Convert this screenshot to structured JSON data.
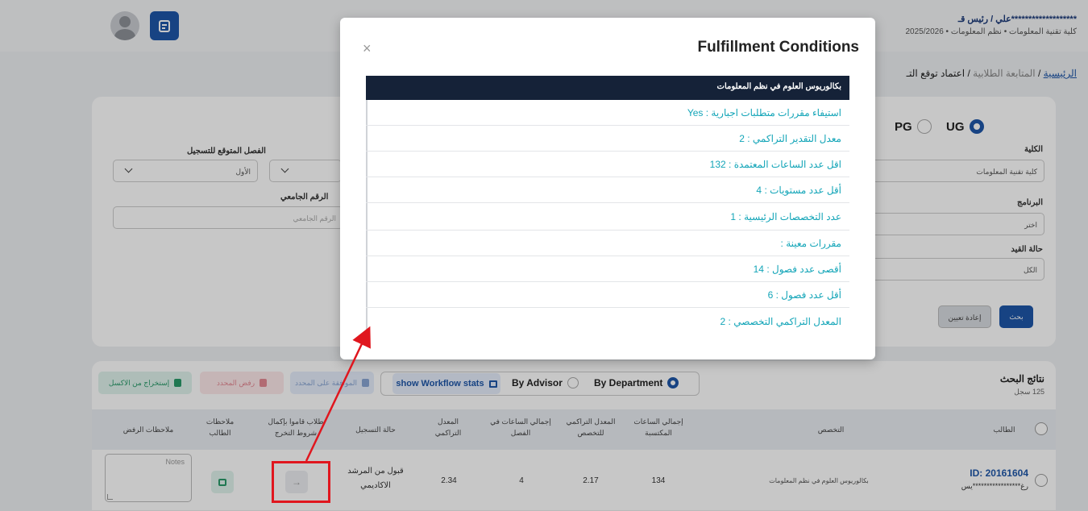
{
  "header": {
    "user_name": "*******************علي / رئيس قـ",
    "user_sub": "كلية تقنية المعلومات  •  نظم المعلومات  •  2025/2026",
    "breadcrumb_home": "الرئيسية",
    "breadcrumb_mid": "المتابعة الطلابية",
    "breadcrumb_current": "اعتماد توقع التـ",
    "sep": " / "
  },
  "filters": {
    "ug_label": "UG",
    "pg_label": "PG",
    "college_label": "الكلية",
    "college_value": "كلية تقنية المعلومات",
    "program_label": "البرنامج",
    "program_value": "اختر",
    "status_label": "حالة القيد",
    "status_value": "الكل",
    "semester_label": "الفصل المتوقع للتسجيل",
    "semester_value": "الأول",
    "univ_id_label": "الرقم الجامعي",
    "univ_id_placeholder": "الرقم الجامعي",
    "search_btn": "بحث",
    "reset_btn": "إعادة تعيين"
  },
  "results": {
    "title": "نتائج البحث",
    "count": "125 سجل",
    "export_btn": "إستخراج من الاكسل",
    "reject_btn": "رفض المحدد",
    "approve_btn": "الموافقة على المحدد",
    "workflow_btn": "show Workflow stats",
    "by_advisor": "By Advisor",
    "by_department": "By Department",
    "columns": {
      "student": "الطالب",
      "major": "التخصص",
      "total_hours": "إجمالي الساعات المكتسبة",
      "major_gpa": "المعدل التراكمي للتخصص",
      "sem_hours": "إجمالي الساعات في الفصل",
      "gpa": "المعدل التراكمي",
      "reg_status": "حالة التسجيل",
      "fulfilled": "طلاب قاموا بإكمال شروط التخرج",
      "student_notes": "ملاحظات الطالب",
      "reject_notes": "ملاحظات الرفض"
    },
    "row": {
      "id": "ID: 20161604",
      "name": "رغ*****************يس",
      "major": "بكالوريوس العلوم في نظم المعلومات",
      "total_hours": "134",
      "major_gpa": "2.17",
      "sem_hours": "4",
      "gpa": "2.34",
      "reg_status": "قبول من المرشد الاكاديمي",
      "notes_placeholder": "Notes",
      "arrow": "→"
    }
  },
  "modal": {
    "title": "Fulfillment Conditions",
    "close": "×",
    "program": "بكالوريوس العلوم في نظم المعلومات",
    "conditions": [
      "استيفاء مقررات متطلبات اجبارية : Yes",
      "معدل التقدير التراكمي : 2",
      "اقل عدد الساعات المعتمدة : 132",
      "أقل عدد مستويات : 4",
      "عدد التخصصات الرئيسية : 1",
      "مقررات معينة :",
      "أقصى عدد فصول : 14",
      "أقل عدد فصول : 6",
      "المعدل التراكمي التخصصي : 2"
    ]
  },
  "colors": {
    "primary": "#1e56a8",
    "modal_header": "#152238",
    "condition_text": "#13a5b8",
    "annotation": "#e0161e"
  }
}
